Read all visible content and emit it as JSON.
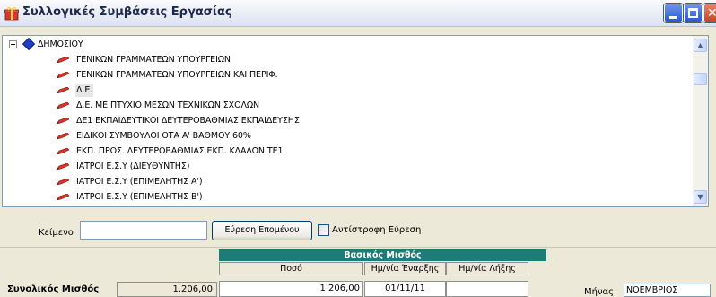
{
  "window": {
    "title": "Συλλογικές Συμβάσεις Εργασίας",
    "icon": "gift-icon",
    "buttons": [
      "minimize-icon",
      "maximize-icon",
      "close-icon"
    ]
  },
  "tree": {
    "root": {
      "label": "ΔΗΜΟΣΙΟΥ",
      "expanded": true,
      "icon": "blue-diamond-icon"
    },
    "items": [
      {
        "label": "ΓΕΝΙΚΩΝ ΓΡΑΜΜΑΤΕΩΝ ΥΠΟΥΡΓΕΙΩΝ",
        "icon": "pencil-icon"
      },
      {
        "label": "ΓΕΝΙΚΩΝ ΓΡΑΜΜΑΤΕΩΝ ΥΠΟΥΡΓΕΙΩΝ ΚΑΙ ΠΕΡΙΦ.",
        "icon": "pencil-icon"
      },
      {
        "label": "Δ.Ε.",
        "icon": "pencil-icon",
        "selected": true
      },
      {
        "label": "Δ.Ε. ΜΕ ΠΤΥΧΙΟ ΜΕΣΩΝ ΤΕΧΝΙΚΩΝ ΣΧΟΛΩΝ",
        "icon": "pencil-icon"
      },
      {
        "label": "ΔΕ1 ΕΚΠΑΙΔΕΥΤΙΚΟΙ ΔΕΥΤΕΡΟΒΑΘΜΙΑΣ ΕΚΠΑΙΔΕΥΣΗΣ",
        "icon": "pencil-icon"
      },
      {
        "label": "ΕΙΔΙΚΟΙ ΣΥΜΒΟΥΛΟΙ ΟΤΑ Α' ΒΑΘΜΟΥ 60%",
        "icon": "pencil-icon"
      },
      {
        "label": "ΕΚΠ. ΠΡΟΣ. ΔΕΥΤΕΡΟΒΑΘΜΙΑΣ ΕΚΠ. ΚΛΑΔΩΝ ΤΕ1",
        "icon": "pencil-icon"
      },
      {
        "label": "ΙΑΤΡΟΙ Ε.Σ.Υ (ΔΙΕΥΘΥΝΤΗΣ)",
        "icon": "pencil-icon"
      },
      {
        "label": "ΙΑΤΡΟΙ Ε.Σ.Υ (ΕΠΙΜΕΛΗΤΗΣ Α')",
        "icon": "pencil-icon"
      },
      {
        "label": "ΙΑΤΡΟΙ Ε.Σ.Υ (ΕΠΙΜΕΛΗΤΗΣ Β')",
        "icon": "pencil-icon"
      }
    ]
  },
  "search": {
    "label": "Κείμενο",
    "value": "",
    "find_next_label": "Εύρεση Επομένου",
    "reverse_label": "Αντίστροφη Εύρεση",
    "reverse_checked": false
  },
  "salary": {
    "total_label": "Συνολικός Μισθός",
    "total_value": "1.206,00",
    "base_header": "Βασικός Μισθός",
    "columns": [
      "Ποσό",
      "Ημ/νία Έναρξης",
      "Ημ/νία Λήξης"
    ],
    "row": {
      "amount": "1.206,00",
      "start": "01/11/11",
      "end": ""
    },
    "header_color": "#1e7b75",
    "month_label": "Μήνας",
    "month_value": "ΝΟΕΜΒΡΙΟΣ"
  }
}
